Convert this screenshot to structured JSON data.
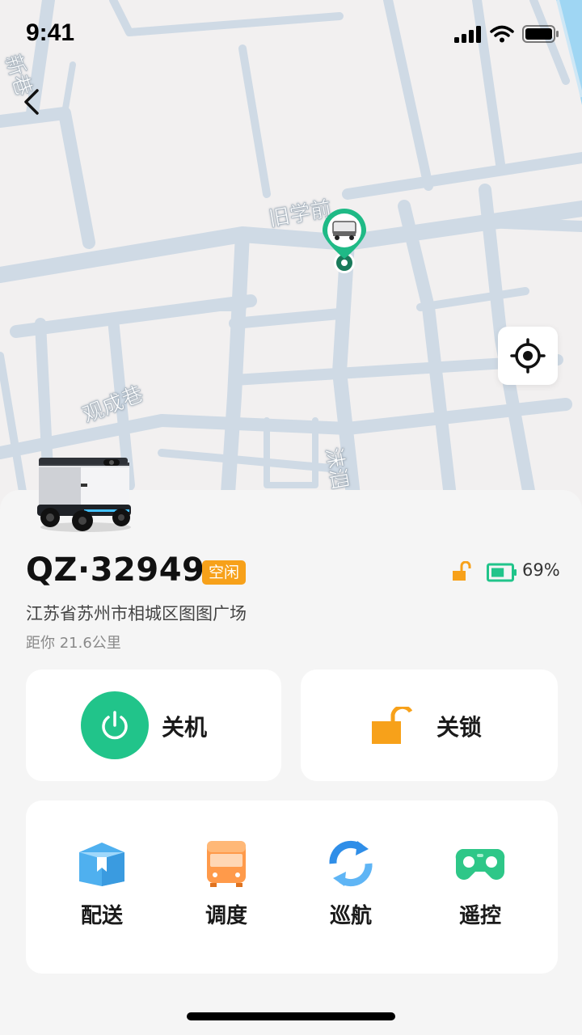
{
  "status_bar": {
    "time": "9:41"
  },
  "map": {
    "road_labels": [
      "新巷",
      "旧学前",
      "观成巷",
      "沫泗"
    ]
  },
  "vehicle": {
    "plate": "QZ·32949",
    "status_tag": "空闲",
    "battery_percent": "69%",
    "battery_level": 0.69,
    "address": "江苏省苏州市相城区图图广场",
    "distance": "距你 21.6公里"
  },
  "controls": {
    "power_label": "关机",
    "lock_label": "关锁"
  },
  "functions": [
    {
      "label": "配送",
      "icon": "delivery-box-icon"
    },
    {
      "label": "调度",
      "icon": "bus-icon"
    },
    {
      "label": "巡航",
      "icon": "cycle-arrows-icon"
    },
    {
      "label": "遥控",
      "icon": "gamepad-icon"
    }
  ],
  "colors": {
    "accent_green": "#21c48a",
    "pin_green": "#1fba86",
    "tag_orange": "#f7a11a",
    "lock_orange": "#f7a11a",
    "road_blue": "#cdd9e4"
  }
}
